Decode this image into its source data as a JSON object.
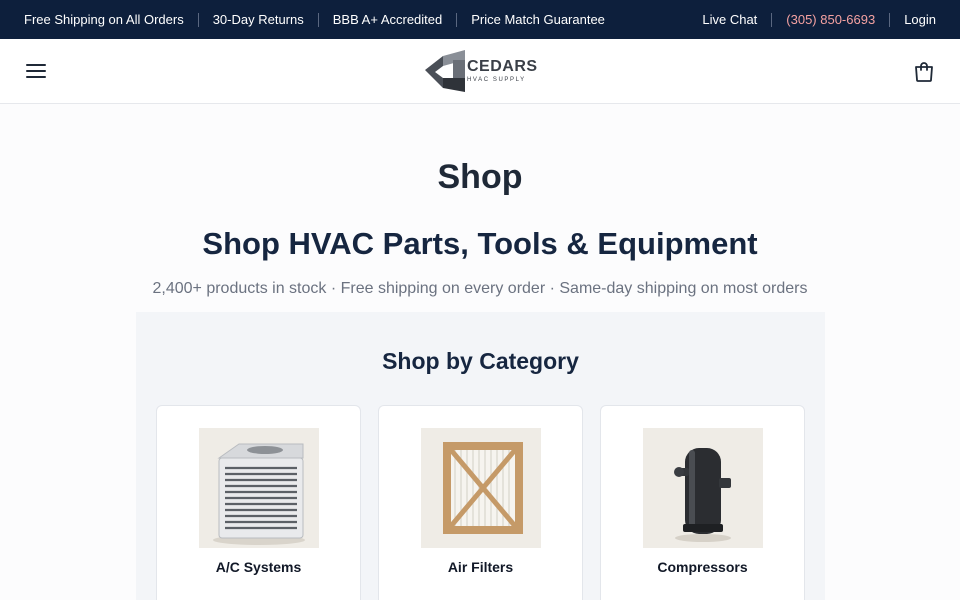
{
  "topbar": {
    "left_items": [
      "Free Shipping on All Orders",
      "30-Day Returns",
      "BBB A+ Accredited",
      "Price Match Guarantee"
    ],
    "live_chat": "Live Chat",
    "phone": "(305) 850-6693",
    "login": "Login"
  },
  "header": {
    "logo_name": "CEDARS",
    "logo_sub": "HVAC SUPPLY",
    "menu_icon": "hamburger-menu-icon",
    "cart_icon": "shopping-bag-icon"
  },
  "main": {
    "page_title": "Shop",
    "hero_title": "Shop HVAC Parts, Tools & Equipment",
    "hero_subtitle": "2,400+ products in stock · Free shipping on every order · Same-day shipping on most orders",
    "category_section_title": "Shop by Category",
    "categories": [
      {
        "label": "A/C Systems"
      },
      {
        "label": "Air Filters"
      },
      {
        "label": "Compressors"
      }
    ]
  },
  "colors": {
    "topbar_bg": "#0d1f3c",
    "phone_accent": "#f4a1a1",
    "heading_navy": "#162640"
  }
}
